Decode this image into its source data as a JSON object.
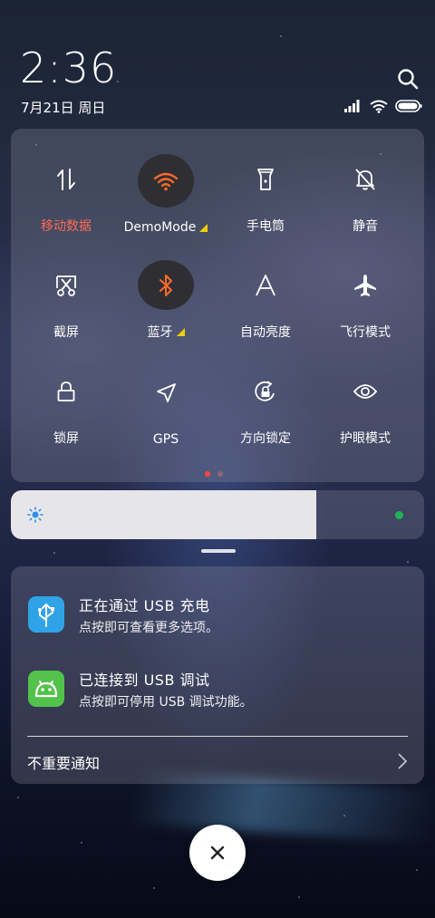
{
  "status": {
    "time": "2:36",
    "date": "7月21日 周日"
  },
  "quick_settings": {
    "tiles": [
      {
        "label": "移动数据",
        "icon": "mobile-data-icon",
        "active": false,
        "label_color": "#ff6a5a"
      },
      {
        "label": "DemoMode",
        "icon": "wifi-icon",
        "active": true,
        "has_arrow": true
      },
      {
        "label": "手电筒",
        "icon": "flashlight-icon",
        "active": false
      },
      {
        "label": "静音",
        "icon": "mute-bell-icon",
        "active": false
      },
      {
        "label": "截屏",
        "icon": "screenshot-icon",
        "active": false
      },
      {
        "label": "蓝牙",
        "icon": "bluetooth-icon",
        "active": true,
        "has_arrow": true
      },
      {
        "label": "自动亮度",
        "icon": "auto-brightness-icon",
        "active": false
      },
      {
        "label": "飞行模式",
        "icon": "airplane-icon",
        "active": false
      },
      {
        "label": "锁屏",
        "icon": "lock-icon",
        "active": false
      },
      {
        "label": "GPS",
        "icon": "location-icon",
        "active": false
      },
      {
        "label": "方向锁定",
        "icon": "rotation-lock-icon",
        "active": false
      },
      {
        "label": "护眼模式",
        "icon": "eye-icon",
        "active": false
      }
    ],
    "accent_color": "#ff6a2a",
    "page_count": 2,
    "current_page": 1
  },
  "brightness": {
    "level": 0.74
  },
  "notifications": [
    {
      "title": "正在通过 USB 充电",
      "text": "点按即可查看更多选项。",
      "icon": "usb-icon",
      "icon_color": "#2fa3e6"
    },
    {
      "title": "已连接到 USB 调试",
      "text": "点按即可停用 USB 调试功能。",
      "icon": "android-icon",
      "icon_color": "#52c24a"
    }
  ],
  "unimportant_label": "不重要通知"
}
